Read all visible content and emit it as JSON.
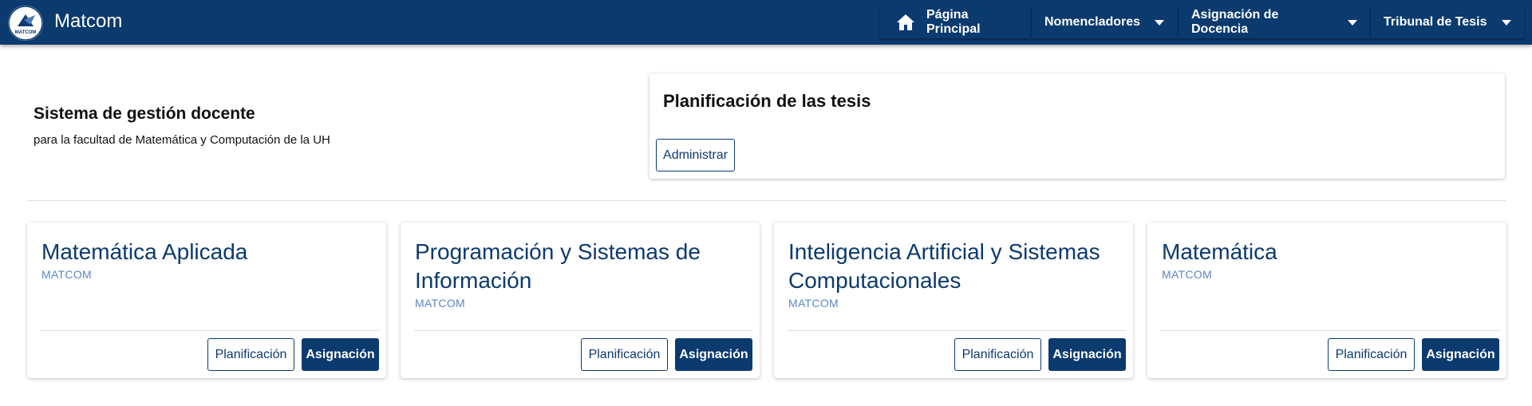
{
  "app": {
    "title": "Matcom",
    "logo_text": "MATCOM",
    "brand_color": "#0b3a6e"
  },
  "nav": {
    "items": [
      {
        "label": "Página Principal",
        "icon": "home-icon"
      },
      {
        "label": "Nomencladores",
        "icon": "caret-down-icon"
      },
      {
        "label": "Asignación de Docencia",
        "icon": "caret-down-icon"
      },
      {
        "label": "Tribunal de Tesis",
        "icon": "caret-down-icon"
      }
    ]
  },
  "intro": {
    "title": "Sistema de gestión docente",
    "subtitle": "para la facultad de Matemática y Computación de la UH"
  },
  "planning": {
    "title": "Planificación de las tesis",
    "admin_label": "Administrar"
  },
  "departments": [
    {
      "name": "Matemática Aplicada",
      "tag": "MATCOM",
      "plan_label": "Planificación",
      "assign_label": "Asignación"
    },
    {
      "name": "Programación y Sistemas de Información",
      "tag": "MATCOM",
      "plan_label": "Planificación",
      "assign_label": "Asignación"
    },
    {
      "name": "Inteligencia Artificial y Sistemas Computacionales",
      "tag": "MATCOM",
      "plan_label": "Planificación",
      "assign_label": "Asignación"
    },
    {
      "name": "Matemática",
      "tag": "MATCOM",
      "plan_label": "Planificación",
      "assign_label": "Asignación"
    }
  ]
}
